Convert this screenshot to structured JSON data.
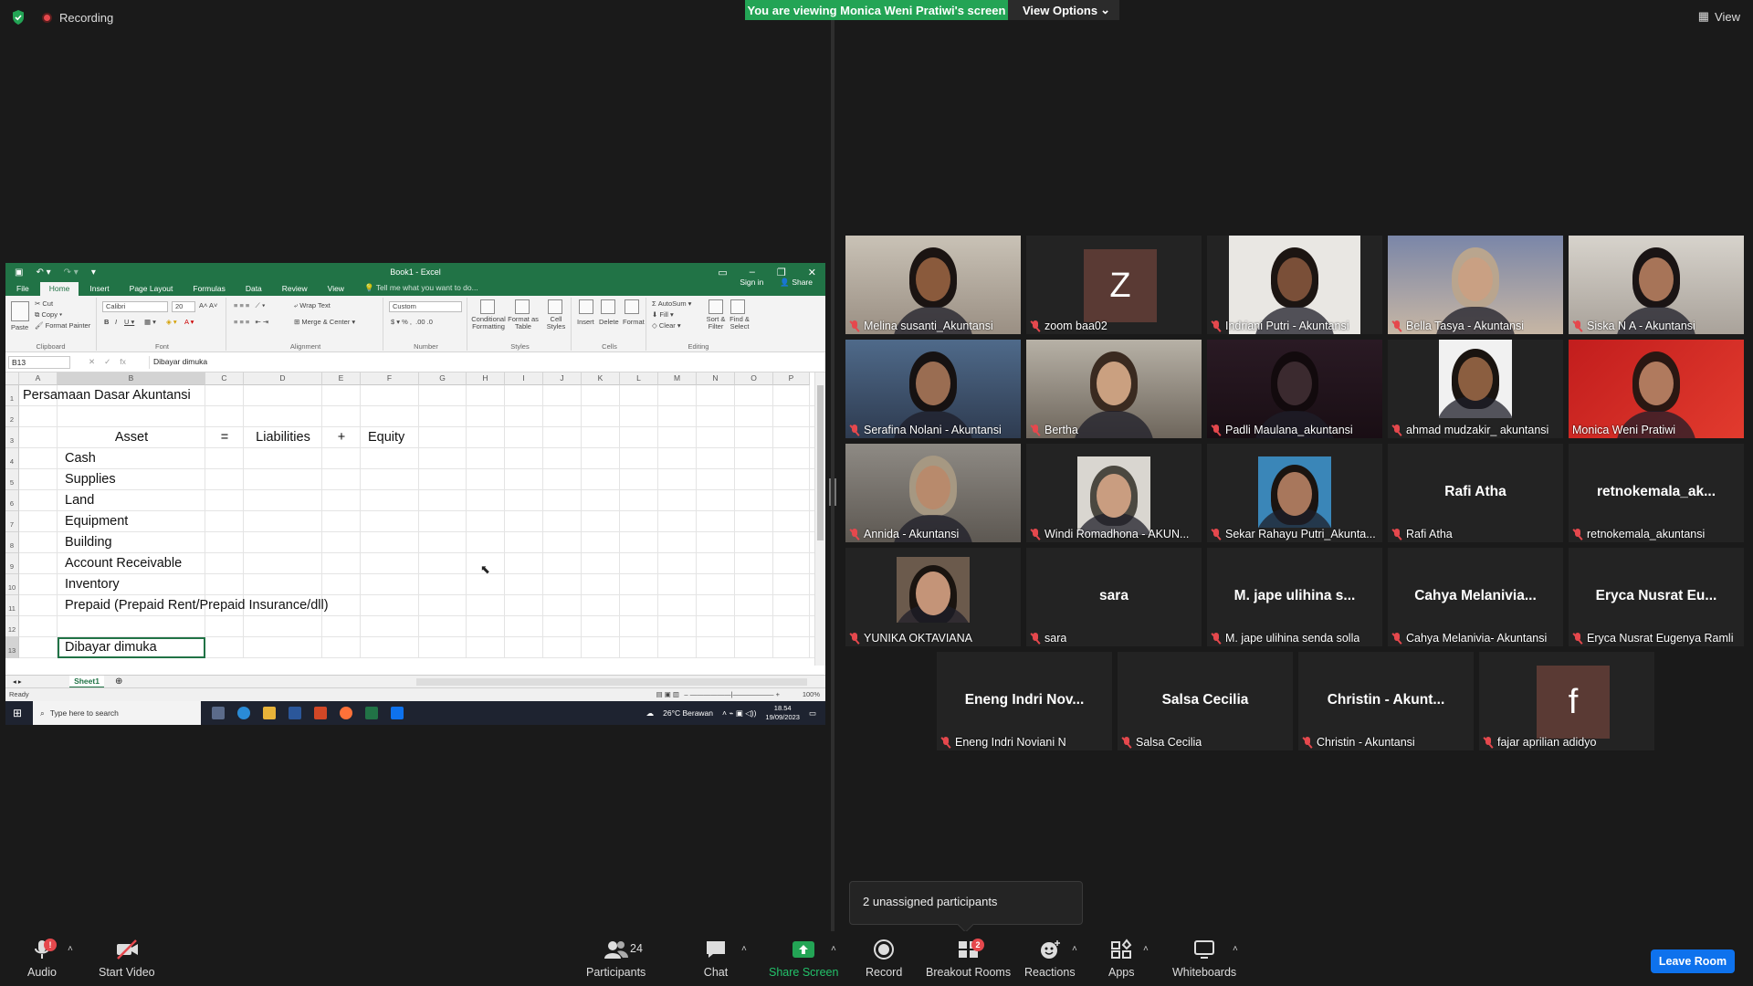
{
  "top": {
    "recording_label": "Recording",
    "banner_text": "You are viewing Monica Weni Pratiwi's screen",
    "view_options_label": "View Options",
    "view_label": "View"
  },
  "excel": {
    "window_title": "Book1 - Excel",
    "tabs": [
      "File",
      "Home",
      "Insert",
      "Page Layout",
      "Formulas",
      "Data",
      "Review",
      "View"
    ],
    "tell_me": "Tell me what you want to do...",
    "sign_in": "Sign in",
    "share": "Share",
    "ribbon": {
      "paste": "Paste",
      "cut": "Cut",
      "copy": "Copy",
      "format_painter": "Format Painter",
      "clipboard": "Clipboard",
      "font_name": "Calibri",
      "font_size": "20",
      "font": "Font",
      "wrap_text": "Wrap Text",
      "merge_center": "Merge & Center",
      "alignment": "Alignment",
      "number_format": "Custom",
      "number": "Number",
      "conditional_formatting": "Conditional Formatting",
      "format_as_table": "Format as Table",
      "cell_styles": "Cell Styles",
      "styles": "Styles",
      "insert": "Insert",
      "delete": "Delete",
      "format": "Format",
      "cells": "Cells",
      "autosum": "AutoSum",
      "fill": "Fill",
      "clear": "Clear",
      "sort_filter": "Sort & Filter",
      "find_select": "Find & Select",
      "editing": "Editing"
    },
    "name_box": "B13",
    "formula": "Dibayar dimuka",
    "columns": [
      "A",
      "B",
      "C",
      "D",
      "E",
      "F",
      "G",
      "H",
      "I",
      "J",
      "K",
      "L",
      "M",
      "N",
      "O",
      "P"
    ],
    "rows": [
      "1",
      "2",
      "3",
      "4",
      "5",
      "6",
      "7",
      "8",
      "9",
      "10",
      "11",
      "12",
      "13"
    ],
    "cells": {
      "A1": "Persamaan Dasar Akuntansi",
      "B3": "Asset",
      "C3": "=",
      "D3": "Liabilities",
      "E3": "+",
      "F3": "Equity",
      "B4": "Cash",
      "B5": "Supplies",
      "B6": "Land",
      "B7": "Equipment",
      "B8": "Building",
      "B9": "Account Receivable",
      "B10": "Inventory",
      "B11": "Prepaid (Prepaid Rent/Prepaid Insurance/dll)",
      "B13": "Dibayar dimuka"
    },
    "sheet_tab": "Sheet1",
    "status": "Ready",
    "zoom": "100%"
  },
  "taskbar": {
    "search_placeholder": "Type here to search",
    "weather": "26°C  Berawan",
    "time": "18.54",
    "date": "19/09/2023"
  },
  "participants": [
    {
      "name": "Melina susanti_Akuntansi"
    },
    {
      "name": "zoom baa02",
      "letter": "Z"
    },
    {
      "name": "Indriani Putri - Akuntansi"
    },
    {
      "name": "Bella Tasya - Akuntansi"
    },
    {
      "name": "Siska N A - Akuntansi"
    },
    {
      "name": "Serafina Nolani - Akuntansi"
    },
    {
      "name": "Bertha"
    },
    {
      "name": "Padli Maulana_akuntansi"
    },
    {
      "name": "ahmad mudzakir_ akuntansi"
    },
    {
      "name": "Monica Weni Pratiwi"
    },
    {
      "name": "Annida - Akuntansi"
    },
    {
      "name": "Windi Romadhona - AKUN..."
    },
    {
      "name": "Sekar Rahayu Putri_Akunta..."
    },
    {
      "name": "Rafi Atha",
      "display": "Rafi Atha"
    },
    {
      "name": "retnokemala_akuntansi",
      "display": "retnokemala_ak..."
    },
    {
      "name": "YUNIKA OKTAVIANA"
    },
    {
      "name": "sara",
      "display": "sara"
    },
    {
      "name": "M. jape ulihina senda solla",
      "display": "M. jape ulihina s..."
    },
    {
      "name": "Cahya Melanivia- Akuntansi",
      "display": "Cahya  Melanivia..."
    },
    {
      "name": "Eryca Nusrat Eugenya Ramli",
      "display": "Eryca Nusrat Eu..."
    },
    {
      "name": "Eneng Indri Noviani N",
      "display": "Eneng  Indri Nov..."
    },
    {
      "name": "Salsa Cecilia",
      "display": "Salsa Cecilia"
    },
    {
      "name": "Christin  - Akuntansi",
      "display": "Christin  - Akunt..."
    },
    {
      "name": "fajar aprilian adidyo",
      "letter": "f"
    }
  ],
  "unassigned_text": "2 unassigned participants",
  "toolbar": {
    "audio": "Audio",
    "audio_badge": "!",
    "start_video": "Start Video",
    "participants": "Participants",
    "participants_count": "24",
    "chat": "Chat",
    "share_screen": "Share Screen",
    "record": "Record",
    "breakout_rooms": "Breakout Rooms",
    "breakout_badge": "2",
    "reactions": "Reactions",
    "apps": "Apps",
    "whiteboards": "Whiteboards",
    "leave_room": "Leave Room"
  },
  "colors": {
    "zoom_green": "#23a455",
    "excel_green": "#217346",
    "leave_blue": "#0e72ed",
    "active_speaker": "#e2e35a",
    "mute_red": "#e5484d"
  }
}
